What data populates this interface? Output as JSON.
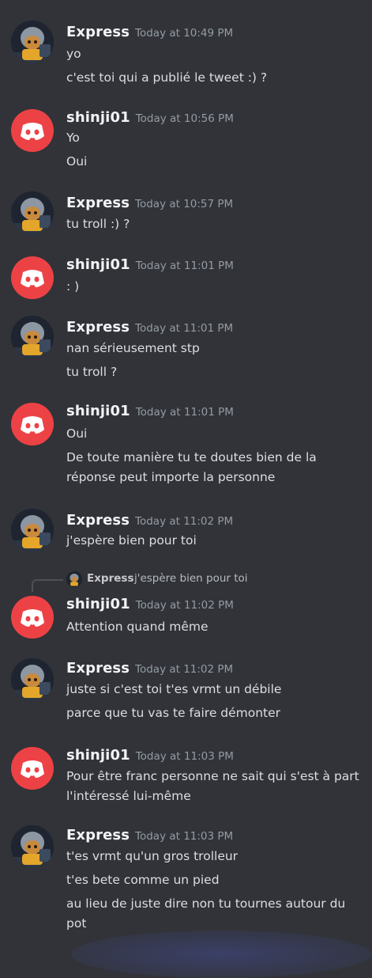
{
  "messages": [
    {
      "author": "Express",
      "time": "Today at 10:49 PM",
      "avatar": "express-avatar",
      "lines": [
        "yo",
        "c'est toi qui a publié le tweet :) ?"
      ]
    },
    {
      "author": "shinji01",
      "time": "Today at 10:56 PM",
      "avatar": "discord-logo",
      "lines": [
        "Yo",
        "Oui"
      ]
    },
    {
      "author": "Express",
      "time": "Today at 10:57 PM",
      "avatar": "express-avatar",
      "lines": [
        "tu troll :) ?"
      ]
    },
    {
      "author": "shinji01",
      "time": "Today at 11:01 PM",
      "avatar": "discord-logo",
      "lines": [
        ": )"
      ]
    },
    {
      "author": "Express",
      "time": "Today at 11:01 PM",
      "avatar": "express-avatar",
      "lines": [
        "nan sérieusement stp",
        "tu troll ?"
      ]
    },
    {
      "author": "shinji01",
      "time": "Today at 11:01 PM",
      "avatar": "discord-logo",
      "lines": [
        "Oui",
        "De toute manière tu te doutes bien de la réponse peut importe la personne"
      ]
    },
    {
      "author": "Express",
      "time": "Today at 11:02 PM",
      "avatar": "express-avatar",
      "lines": [
        "j'espère bien pour toi"
      ]
    },
    {
      "author": "shinji01",
      "time": "Today at 11:02 PM",
      "avatar": "discord-logo",
      "reply": {
        "author": "Express",
        "text": "j'espère bien pour toi"
      },
      "lines": [
        "Attention quand même"
      ]
    },
    {
      "author": "Express",
      "time": "Today at 11:02 PM",
      "avatar": "express-avatar",
      "lines": [
        "juste si c'est toi t'es vrmt un débile",
        "parce que tu vas te faire démonter"
      ]
    },
    {
      "author": "shinji01",
      "time": "Today at 11:03 PM",
      "avatar": "discord-logo",
      "lines": [
        "Pour être franc personne ne sait qui s'est à part l'intéressé lui-même"
      ]
    },
    {
      "author": "Express",
      "time": "Today at 11:03 PM",
      "avatar": "express-avatar",
      "lines": [
        "t'es vrmt qu'un gros trolleur",
        "t'es bete comme un pied",
        "au lieu de juste dire non tu tournes autour du pot"
      ]
    }
  ],
  "colors": {
    "background": "#313338",
    "discord_red": "#ed4245",
    "name": "#f2f3f5",
    "timestamp": "#949ba4",
    "text": "#dbdee1"
  }
}
